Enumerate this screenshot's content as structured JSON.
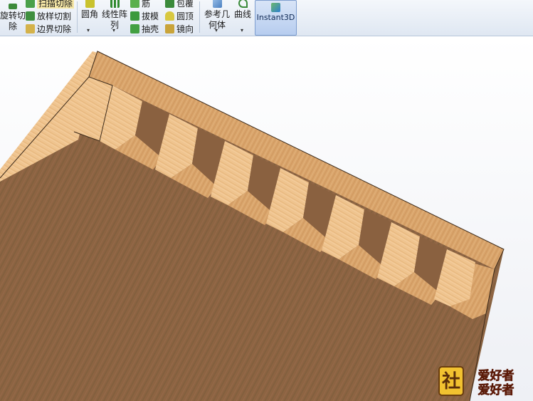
{
  "ribbon": {
    "col1": {
      "label_line1": "旋转切",
      "label_line2": "除"
    },
    "col2": {
      "items": [
        "扫描切除",
        "放样切割",
        "边界切除"
      ]
    },
    "col3": {
      "label": "圆角"
    },
    "col4": {
      "label_line1": "线性阵",
      "label_line2": "列"
    },
    "col5": {
      "items": [
        "筋",
        "拔模",
        "抽壳"
      ]
    },
    "col6": {
      "items": [
        "包覆",
        "圆顶",
        "镜向"
      ]
    },
    "col7": {
      "label_line1": "参考几",
      "label_line2": "何体"
    },
    "col8": {
      "label": "曲线"
    },
    "instant3d": {
      "label": "Instant3D"
    }
  },
  "heads_up_toolbar": {
    "icons": [
      "zoom-to-fit-icon",
      "zoom-area-icon",
      "previous-view-icon",
      "section-view-icon",
      "view-orientation-icon",
      "display-style-icon",
      "hide-show-icon",
      "edit-appearance-icon",
      "apply-scene-icon",
      "view-settings-icon"
    ]
  },
  "colors": {
    "ribbon_bg": "#e6edf6",
    "wood_light": "#f0c48c",
    "wood_mid": "#d9a063",
    "wood_dark": "#8a6140",
    "accent": "#7d9dcf"
  },
  "watermark": {
    "text": "爱好者"
  }
}
